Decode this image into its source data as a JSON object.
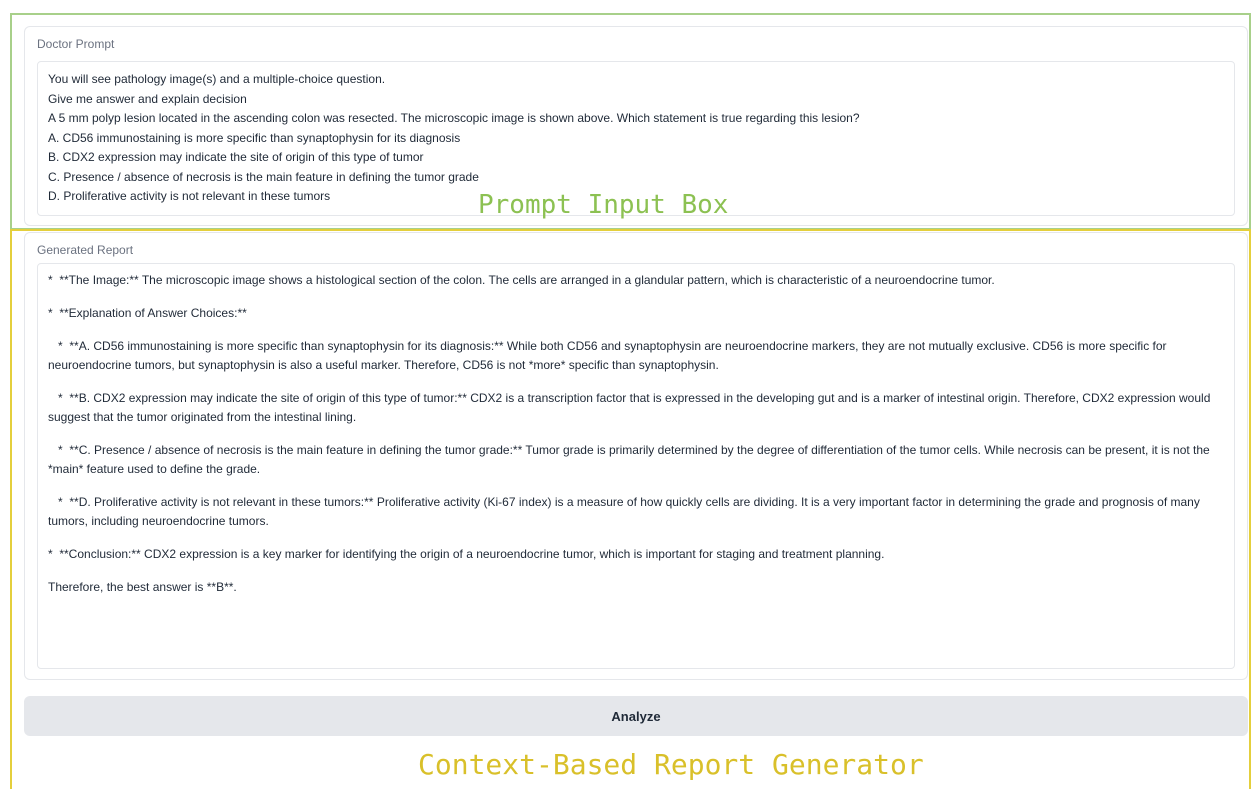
{
  "prompt": {
    "label": "Doctor Prompt",
    "lines": [
      "You will see pathology image(s) and a multiple-choice question.",
      "Give me answer and explain decision",
      "A 5 mm polyp lesion located in the ascending colon was resected. The microscopic image is shown above. Which statement is true regarding this lesion?",
      "A. CD56 immunostaining is more specific than synaptophysin for its diagnosis",
      "B. CDX2 expression may indicate the site of origin of this type of tumor",
      "C. Presence / absence of necrosis is the main feature in defining the tumor grade",
      "D. Proliferative activity is not relevant in these tumors"
    ]
  },
  "report": {
    "label": "Generated Report",
    "paragraphs": [
      "*  **The Image:** The microscopic image shows a histological section of the colon. The cells are arranged in a glandular pattern, which is characteristic of a neuroendocrine tumor.",
      "*  **Explanation of Answer Choices:**",
      "   *  **A. CD56 immunostaining is more specific than synaptophysin for its diagnosis:** While both CD56 and synaptophysin are neuroendocrine markers, they are not mutually exclusive. CD56 is more specific for neuroendocrine tumors, but synaptophysin is also a useful marker. Therefore, CD56 is not *more* specific than synaptophysin.",
      "   *  **B. CDX2 expression may indicate the site of origin of this type of tumor:** CDX2 is a transcription factor that is expressed in the developing gut and is a marker of intestinal origin. Therefore, CDX2 expression would suggest that the tumor originated from the intestinal lining.",
      "   *  **C. Presence / absence of necrosis is the main feature in defining the tumor grade:** Tumor grade is primarily determined by the degree of differentiation of the tumor cells. While necrosis can be present, it is not the *main* feature used to define the grade.",
      "   *  **D. Proliferative activity is not relevant in these tumors:** Proliferative activity (Ki-67 index) is a measure of how quickly cells are dividing. It is a very important factor in determining the grade and prognosis of many tumors, including neuroendocrine tumors.",
      "*  **Conclusion:** CDX2 expression is a key marker for identifying the origin of a neuroendocrine tumor, which is important for staging and treatment planning.",
      "Therefore, the best answer is **B**."
    ]
  },
  "analyze_button": {
    "label": "Analyze"
  },
  "annotations": {
    "prompt_box": "Prompt Input Box",
    "report_generator": "Context-Based Report Generator"
  },
  "colors": {
    "prompt_frame": "#a8d08a",
    "report_frame": "#e4cf3c",
    "button_bg": "#e5e7eb"
  }
}
